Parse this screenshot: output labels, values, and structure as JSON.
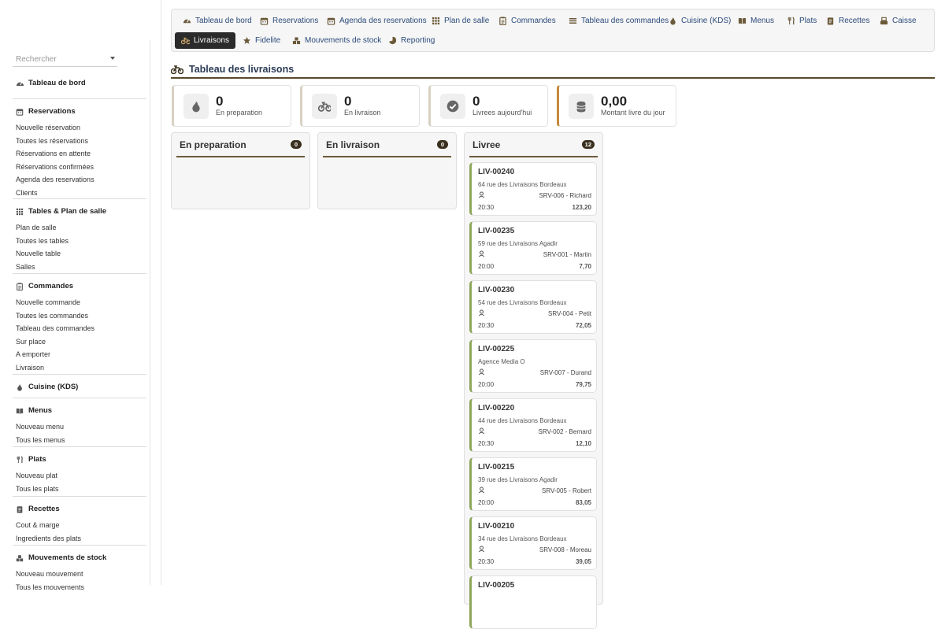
{
  "colors": {
    "accent_dark": "#2b2b2b",
    "rule": "#5a4a2c",
    "card_border_left": "#8da65a",
    "badge_bg": "#3a2f1e",
    "kpi_accent": "#c58a3a"
  },
  "sidebar": {
    "search_placeholder": "Rechercher",
    "dashboard": {
      "label": "Tableau de bord",
      "icon": "gauge-icon"
    },
    "groups": [
      {
        "title": "Reservations",
        "icon": "calendar-icon",
        "items": [
          "Nouvelle réservation",
          "Toutes les réservations",
          "Réservations en attente",
          "Réservations confirmées",
          "Agenda des reservations",
          "Clients"
        ]
      },
      {
        "title": "Tables & Plan de salle",
        "icon": "grid-icon",
        "items": [
          "Plan de salle",
          "Toutes les tables",
          "Nouvelle table",
          "Salles"
        ]
      },
      {
        "title": "Commandes",
        "icon": "clipboard-icon",
        "items": [
          "Nouvelle commande",
          "Toutes les commandes",
          "Tableau des commandes",
          "Sur place",
          "A emporter",
          "Livraison"
        ]
      },
      {
        "title": "Cuisine (KDS)",
        "icon": "flame-icon",
        "items": []
      },
      {
        "title": "Menus",
        "icon": "book-icon",
        "items": [
          "Nouveau menu",
          "Tous les menus"
        ]
      },
      {
        "title": "Plats",
        "icon": "utensils-icon",
        "items": [
          "Nouveau plat",
          "Tous les plats"
        ]
      },
      {
        "title": "Recettes",
        "icon": "recipe-icon",
        "items": [
          "Cout & marge",
          "Ingredients des plats"
        ]
      },
      {
        "title": "Mouvements de stock",
        "icon": "boxes-icon",
        "items": [
          "Nouveau mouvement",
          "Tous les mouvements"
        ]
      }
    ]
  },
  "topnav": {
    "row1": [
      {
        "label": "Tableau de bord",
        "icon": "gauge-icon"
      },
      {
        "label": "Reservations",
        "icon": "calendar-icon"
      },
      {
        "label": "Agenda des reservations",
        "icon": "calendar-icon"
      },
      {
        "label": "Plan de salle",
        "icon": "grid-icon"
      },
      {
        "label": "Commandes",
        "icon": "clipboard-icon"
      },
      {
        "label": "Tableau des commandes",
        "icon": "list-icon"
      },
      {
        "label": "Cuisine (KDS)",
        "icon": "flame-icon"
      },
      {
        "label": "Menus",
        "icon": "book-icon"
      },
      {
        "label": "Plats",
        "icon": "utensils-icon"
      },
      {
        "label": "Recettes",
        "icon": "recipe-icon"
      },
      {
        "label": "Caisse",
        "icon": "register-icon"
      }
    ],
    "row2": [
      {
        "label": "Livraisons",
        "icon": "motorcycle-icon",
        "active": true
      },
      {
        "label": "Fidelite",
        "icon": "star-icon"
      },
      {
        "label": "Mouvements de stock",
        "icon": "boxes-icon"
      },
      {
        "label": "Reporting",
        "icon": "pie-icon"
      }
    ]
  },
  "page": {
    "title": "Tableau des livraisons",
    "icon": "motorcycle-icon"
  },
  "kpis": [
    {
      "value": "0",
      "label": "En preparation",
      "icon": "flame-icon"
    },
    {
      "value": "0",
      "label": "En livraison",
      "icon": "motorcycle-icon"
    },
    {
      "value": "0",
      "label": "Livrees aujourd'hui",
      "icon": "check-circle-icon"
    },
    {
      "value": "0,00",
      "label": "Montant livre du jour",
      "icon": "coins-icon"
    }
  ],
  "columns": [
    {
      "title": "En preparation",
      "count": "0",
      "cards": []
    },
    {
      "title": "En livraison",
      "count": "0",
      "cards": []
    },
    {
      "title": "Livree",
      "count": "12",
      "cards": [
        {
          "id": "LIV-00240",
          "address": "64 rue des Livraisons Bordeaux",
          "server": "SRV-006 - Richard",
          "time": "20:30",
          "amount": "123,20"
        },
        {
          "id": "LIV-00235",
          "address": "59 rue des Livraisons Agadir",
          "server": "SRV-001 - Martin",
          "time": "20:00",
          "amount": "7,70"
        },
        {
          "id": "LIV-00230",
          "address": "54 rue des Livraisons Bordeaux",
          "server": "SRV-004 - Petit",
          "time": "20:30",
          "amount": "72,05"
        },
        {
          "id": "LIV-00225",
          "address": "Agence Media O",
          "server": "SRV-007 - Durand",
          "time": "20:00",
          "amount": "79,75"
        },
        {
          "id": "LIV-00220",
          "address": "44 rue des Livraisons Bordeaux",
          "server": "SRV-002 - Bernard",
          "time": "20:30",
          "amount": "12,10"
        },
        {
          "id": "LIV-00215",
          "address": "39 rue des Livraisons Agadir",
          "server": "SRV-005 - Robert",
          "time": "20:00",
          "amount": "83,05"
        },
        {
          "id": "LIV-00210",
          "address": "34 rue des Livraisons Bordeaux",
          "server": "SRV-008 - Moreau",
          "time": "20:30",
          "amount": "39,05"
        },
        {
          "id": "LIV-00205",
          "address": "",
          "server": "",
          "time": "",
          "amount": ""
        }
      ]
    }
  ]
}
